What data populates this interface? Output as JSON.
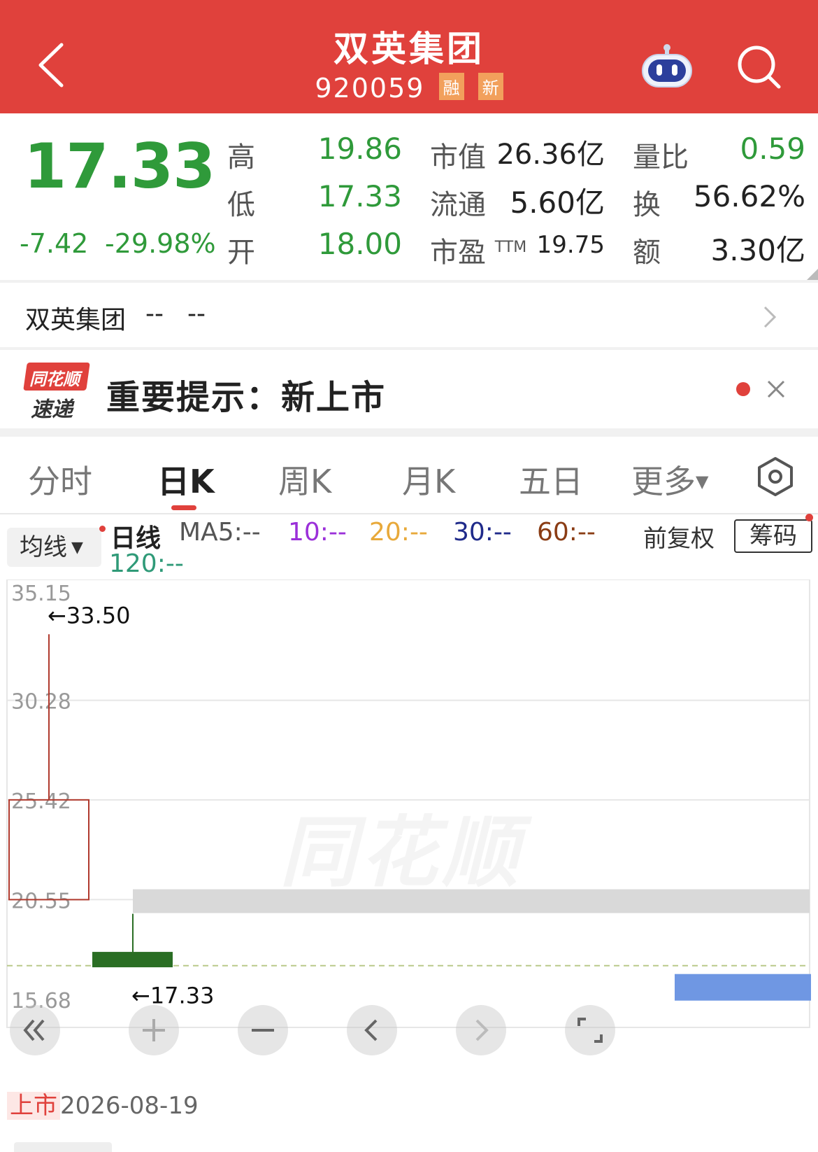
{
  "header": {
    "title": "双英集团",
    "code": "920059",
    "tags": [
      "融",
      "新"
    ]
  },
  "quote": {
    "price": "17.33",
    "change": "-7.42",
    "change_pct": "-29.98%",
    "high_label": "高",
    "high": "19.86",
    "low_label": "低",
    "low": "17.33",
    "open_label": "开",
    "open": "18.00",
    "mktcap_label": "市值",
    "mktcap": "26.36亿",
    "float_label": "流通",
    "float": "5.60亿",
    "pe_label": "市盈",
    "pe_sup": "TTM",
    "pe": "19.75",
    "volratio_label": "量比",
    "volratio": "0.59",
    "turnover_label": "换",
    "turnover": "56.62%",
    "amount_label": "额",
    "amount": "3.30亿",
    "colors": {
      "down": "#2f9a3a",
      "brand": "#e0413c"
    }
  },
  "stock_row": {
    "name": "双英集团",
    "v1": "--",
    "v2": "--"
  },
  "alert": {
    "logo_line1": "同花顺",
    "logo_line2": "速递",
    "text": "重要提示：新上市"
  },
  "tabs": [
    "分时",
    "日K",
    "周K",
    "月K",
    "五日",
    "更多"
  ],
  "active_tab": "日K",
  "ma_row": {
    "ma_button": "均线",
    "period": "日线",
    "ma5": "MA5:--",
    "ma10": "10:--",
    "ma20": "20:--",
    "ma30": "30:--",
    "ma60": "60:--",
    "ma120": "120:--",
    "adjust": "前复权",
    "chips": "筹码",
    "colors": {
      "ma10": "#9b30d9",
      "ma20": "#e8a93a",
      "ma30": "#1f2a8a",
      "ma60": "#8a3c14",
      "ma120": "#2f9a78"
    }
  },
  "chart_data": {
    "type": "candlestick",
    "y_ticks": [
      "35.15",
      "30.28",
      "25.42",
      "20.55",
      "15.68"
    ],
    "ylim": [
      15.68,
      35.15
    ],
    "candles": [
      {
        "open": 20.55,
        "high": 33.5,
        "low": 20.55,
        "close": 25.42,
        "color": "red-hollow"
      },
      {
        "open": 18.0,
        "high": 19.86,
        "low": 17.33,
        "close": 17.33,
        "color": "green"
      }
    ],
    "high_marker": "←33.50",
    "low_marker": "←17.33",
    "watermark": "同花顺"
  },
  "controls": [
    "rewind-icon",
    "zoom-in-icon",
    "zoom-out-icon",
    "prev-icon",
    "next-icon",
    "fullscreen-icon"
  ],
  "date_row": {
    "listed_label": "上市",
    "date": "2026-08-19"
  }
}
